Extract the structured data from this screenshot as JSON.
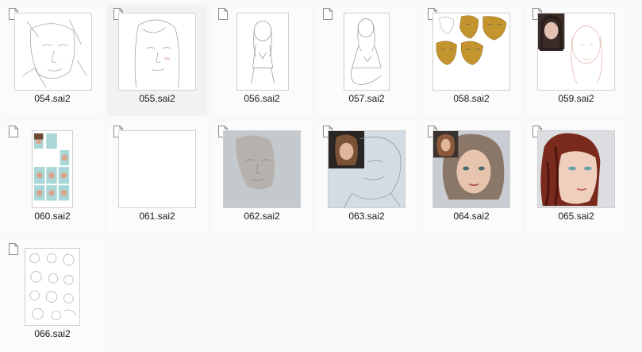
{
  "files": [
    {
      "name": "054.sai2"
    },
    {
      "name": "055.sai2"
    },
    {
      "name": "056.sai2"
    },
    {
      "name": "057.sai2"
    },
    {
      "name": "058.sai2"
    },
    {
      "name": "059.sai2"
    },
    {
      "name": "060.sai2"
    },
    {
      "name": "061.sai2"
    },
    {
      "name": "062.sai2"
    },
    {
      "name": "063.sai2"
    },
    {
      "name": "064.sai2"
    },
    {
      "name": "065.sai2"
    },
    {
      "name": "066.sai2"
    }
  ],
  "icons": {
    "file_badge": "document-icon"
  },
  "colors": {
    "selected_tile": "#f2f2f2",
    "thumb_border": "#cfcfcf",
    "skin_ochre": "#c4952f",
    "teal_bg": "#a9d6d6",
    "gray_bg": "#c3c9cd"
  }
}
